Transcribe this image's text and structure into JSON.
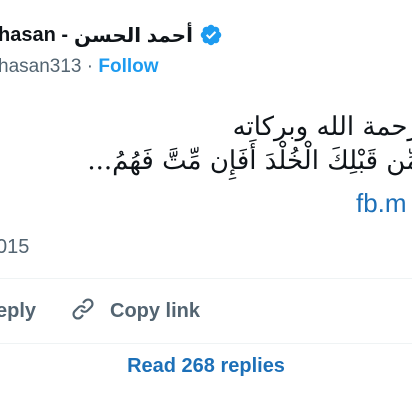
{
  "author": {
    "name_latin": "hasan -",
    "name_arabic": "أحمد الحسن",
    "verified_icon": "verified-badge-icon",
    "handle": "hasan313",
    "separator": "·",
    "follow_label": "Follow"
  },
  "tweet": {
    "line1": "رحمة الله وبركاته",
    "line2": "مِّن قَبْلِكَ الْخُلْدَ أَفَإِن مِّتَّ فَهُمُ...",
    "link_fragment": "fb.m",
    "date_fragment": "015"
  },
  "actions": {
    "reply_label": "eply",
    "copy_link_label": "Copy link",
    "copy_icon": "link-icon"
  },
  "footer": {
    "read_replies_label": "Read 268 replies"
  },
  "colors": {
    "accent": "#1d9bf0",
    "link": "#1d70b8",
    "muted": "#536471",
    "text": "#0f1419"
  }
}
